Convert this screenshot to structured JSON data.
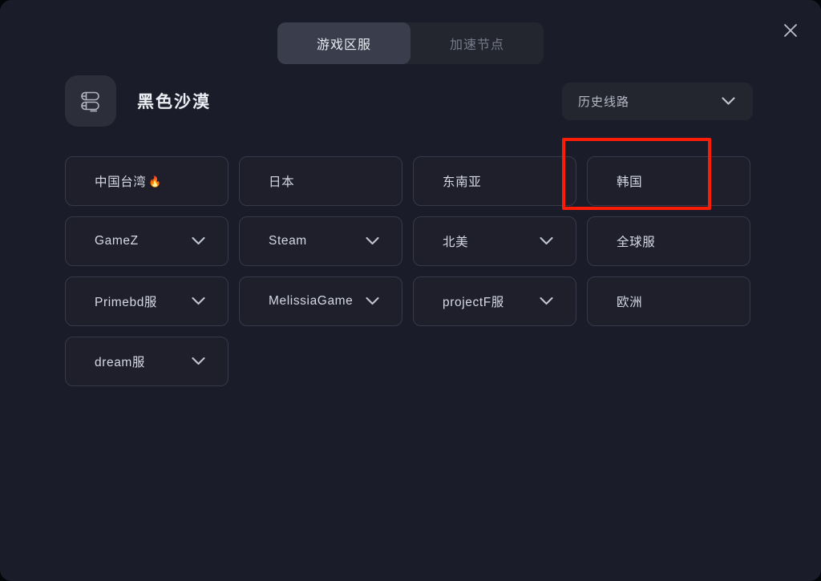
{
  "window": {
    "background_color": "#1b1c29",
    "close_icon": "close-icon"
  },
  "tabs": [
    {
      "label": "游戏区服",
      "active": true
    },
    {
      "label": "加速节点",
      "active": false
    }
  ],
  "header": {
    "icon_name": "game-logo-icon",
    "title": "黑色沙漠"
  },
  "history_select": {
    "label": "历史线路",
    "caret_icon": "chevron-down-icon"
  },
  "servers": [
    [
      {
        "label": "中国台湾",
        "badge": "🔥",
        "caret": false
      },
      {
        "label": "日本",
        "badge": "",
        "caret": false
      },
      {
        "label": "东南亚",
        "badge": "",
        "caret": false
      },
      {
        "label": "韩国",
        "badge": "",
        "caret": false,
        "highlighted": true
      }
    ],
    [
      {
        "label": "GameZ",
        "badge": "",
        "caret": true
      },
      {
        "label": "Steam",
        "badge": "",
        "caret": true
      },
      {
        "label": "北美",
        "badge": "",
        "caret": true
      },
      {
        "label": "全球服",
        "badge": "",
        "caret": false
      }
    ],
    [
      {
        "label": "Primebd服",
        "badge": "",
        "caret": true
      },
      {
        "label": "MelissiaGame",
        "badge": "",
        "caret": true
      },
      {
        "label": "projectF服",
        "badge": "",
        "caret": true
      },
      {
        "label": "欧洲",
        "badge": "",
        "caret": false
      }
    ],
    [
      {
        "label": "dream服",
        "badge": "",
        "caret": true
      }
    ]
  ],
  "annotation": {
    "name": "korea-highlight-box",
    "color": "#f91c06"
  }
}
